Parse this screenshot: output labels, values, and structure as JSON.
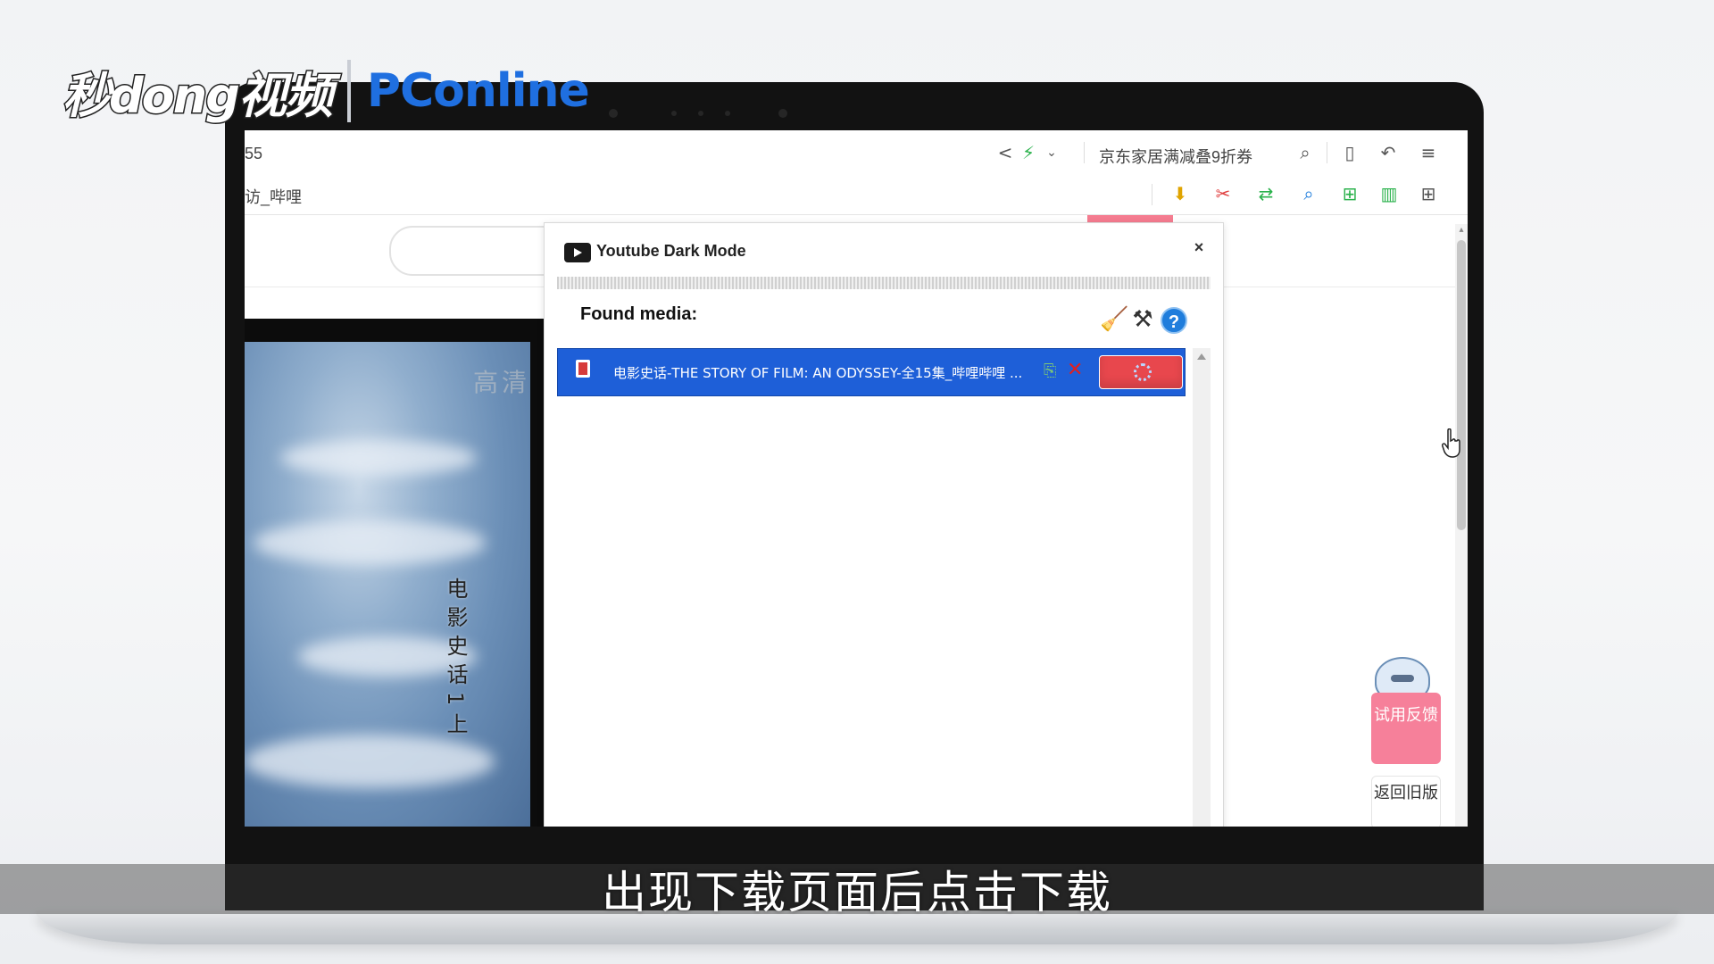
{
  "overlay": {
    "logo_left": "秒dong视频",
    "logo_right": "PConline",
    "subtitle": "出现下载页面后点击下载"
  },
  "browser": {
    "tab_fragment": "55",
    "search_suggestion": "京东家居满减叠9折券",
    "page_tab_fragment": "访_哔哩",
    "icons": [
      "share-icon",
      "bolt-icon",
      "chevron-down-icon",
      "search-icon",
      "bookmark-icon",
      "undo-icon",
      "menu-icon"
    ],
    "ext_icons": [
      "download-arrow-icon",
      "scissors-icon",
      "translate-icon",
      "magnifier-icon",
      "gamepad-icon",
      "reader-icon",
      "grid-icon"
    ]
  },
  "page": {
    "video_watermark": "高清",
    "vertical_title": "电影史话1上",
    "feedback_button": "试用反馈",
    "back_old_button": "返回旧版"
  },
  "popup": {
    "title": "Youtube Dark Mode",
    "close_label": "×",
    "found_label": "Found media:",
    "help_label": "?",
    "media": [
      {
        "title": "电影史话-THE STORY OF FILM: AN ODYSSEY-全15集_哔哩哔哩 ..."
      }
    ]
  },
  "colors": {
    "accent_blue": "#1e5fd8",
    "download_red": "#e8474d",
    "feedback_pink": "#f6809a"
  }
}
